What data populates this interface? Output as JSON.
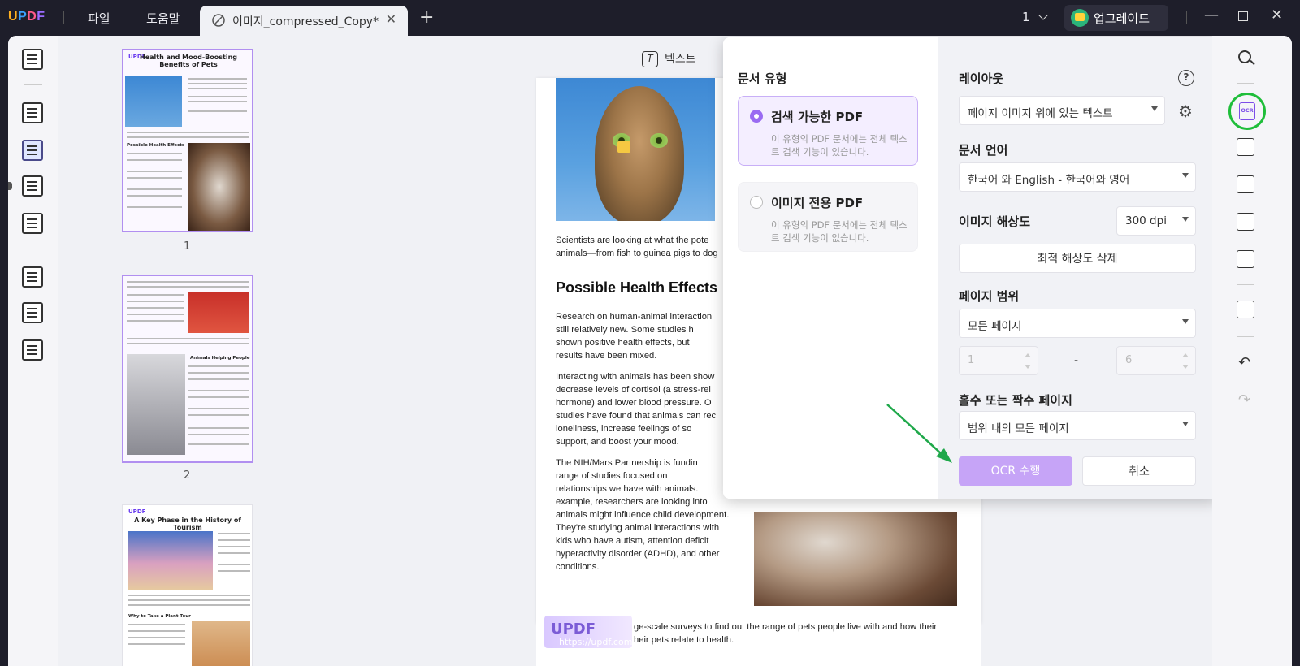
{
  "app": {
    "logo": "UPDF",
    "menus": [
      "파일",
      "도움말"
    ],
    "tab_title": "이미지_compressed_Copy*",
    "page_indicator": "1",
    "upgrade_label": "업그레이드"
  },
  "thumbnails": [
    {
      "number": "1",
      "title": "Health and Mood-Boosting Benefits of Pets",
      "section": "Possible Health Effects"
    },
    {
      "number": "2",
      "title": "",
      "section": "Animals Helping People"
    },
    {
      "number": "",
      "title": "A Key Phase in the History of Tourism",
      "section": "Why to Take a Plant Tour"
    }
  ],
  "toolbar": {
    "text_tool": "텍스트"
  },
  "document": {
    "p1": "Scientists are looking at what the pote",
    "p2": "animals—from fish to guinea pigs to dog",
    "heading": "Possible Health Effects",
    "para1": [
      "Research on human-animal interaction",
      "still relatively new. Some studies h",
      "shown positive health effects, but",
      "results have been mixed."
    ],
    "para2": [
      "Interacting with animals has been show",
      "decrease levels of cortisol (a stress-rel",
      "hormone) and lower blood pressure. O",
      "studies have found that animals can rec",
      "loneliness, increase feelings of so",
      "support, and boost your mood."
    ],
    "para3": [
      "The NIH/Mars Partnership is fundin",
      "range of studies focused on",
      "relationships we have with animals.",
      "example, researchers are looking into",
      "animals might influence child development.",
      "They're studying animal interactions with",
      "kids who have autism, attention deficit",
      "hyperactivity disorder (ADHD), and other",
      "conditions."
    ],
    "page2_line1": "ge-scale surveys to find out the range of pets people live with and how their",
    "page2_line2": "heir pets relate to health.",
    "watermark": "https://updf.com",
    "logo_text": "UPDF"
  },
  "ocr": {
    "doc_type_title": "문서 유형",
    "option_searchable": {
      "title": "검색 가능한 PDF",
      "desc": "이 유형의 PDF 문서에는 전체 텍스트 검색 기능이 있습니다.",
      "selected": true
    },
    "option_image": {
      "title": "이미지 전용 PDF",
      "desc": "이 유형의 PDF 문서에는 전체 텍스트 검색 기능이 없습니다.",
      "selected": false
    },
    "layout_title": "레이아웃",
    "layout_value": "페이지 이미지 위에 있는 텍스트",
    "language_title": "문서 언어",
    "language_value": "한국어 와 English - 한국어와 영어",
    "resolution_title": "이미지 해상도",
    "resolution_value": "300 dpi",
    "delete_resolution_label": "최적 해상도 삭제",
    "page_range_title": "페이지 범위",
    "page_range_value": "모든 페이지",
    "range_from": "1",
    "range_sep": "-",
    "range_to": "6",
    "odd_even_title": "홀수 또는 짝수 페이지",
    "odd_even_value": "범위 내의 모든 페이지",
    "run_label": "OCR 수행",
    "cancel_label": "취소"
  },
  "colors": {
    "accent": "#9a6bf2",
    "primary_button": "#c6a4f7",
    "highlight_circle": "#1fbe3a",
    "arrow": "#1fa84a"
  }
}
